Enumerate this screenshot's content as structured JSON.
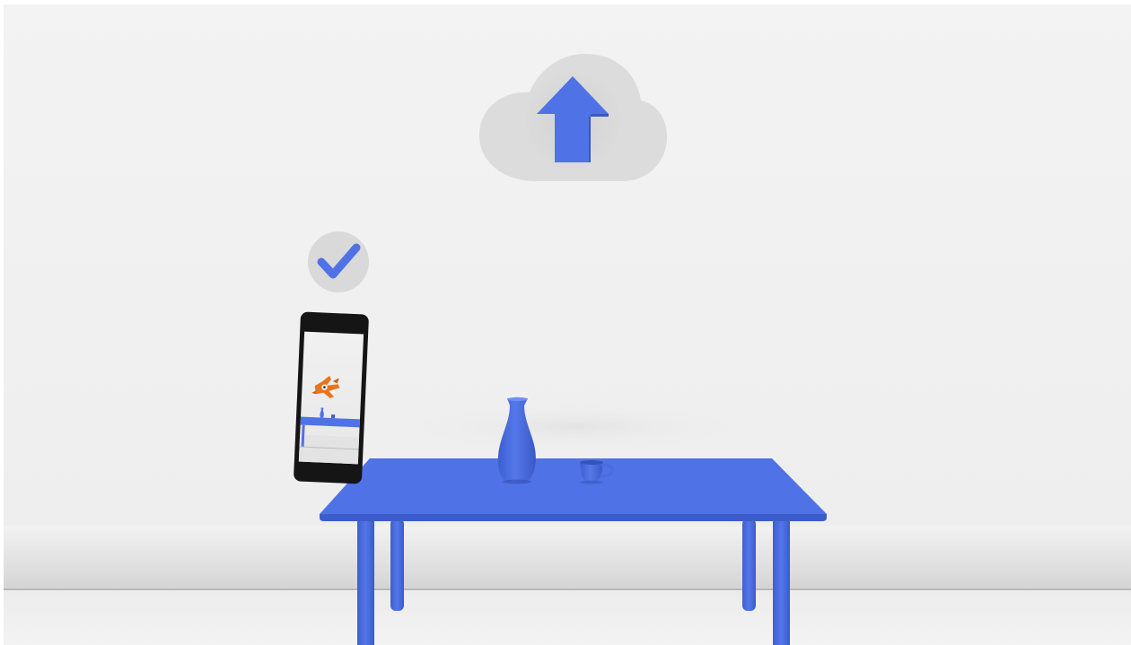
{
  "scene": {
    "colors": {
      "accent_blue": "#4f72e6",
      "wall": "#f1f1f1",
      "floor": "#e6e6e6",
      "badge": "#d9d9d9",
      "phone_body": "#151515",
      "toy_orange": "#e8741c"
    },
    "icons": {
      "cloud": "cloud-upload-icon",
      "check": "checkmark-icon"
    }
  }
}
